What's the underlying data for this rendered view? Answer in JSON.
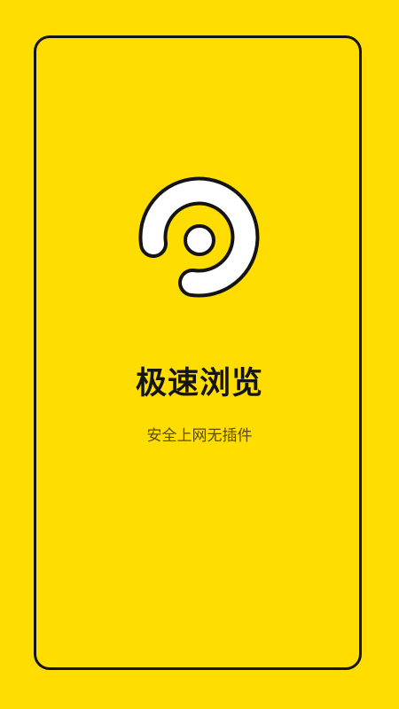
{
  "app": {
    "title": "极速浏览",
    "subtitle": "安全上网无插件"
  },
  "logo": {
    "icon": "swirl-logo-icon"
  },
  "colors": {
    "background": "#FFDD00",
    "outline": "#141414",
    "logo_fill": "#FFFFFF",
    "subtitle": "#5A4A10"
  }
}
